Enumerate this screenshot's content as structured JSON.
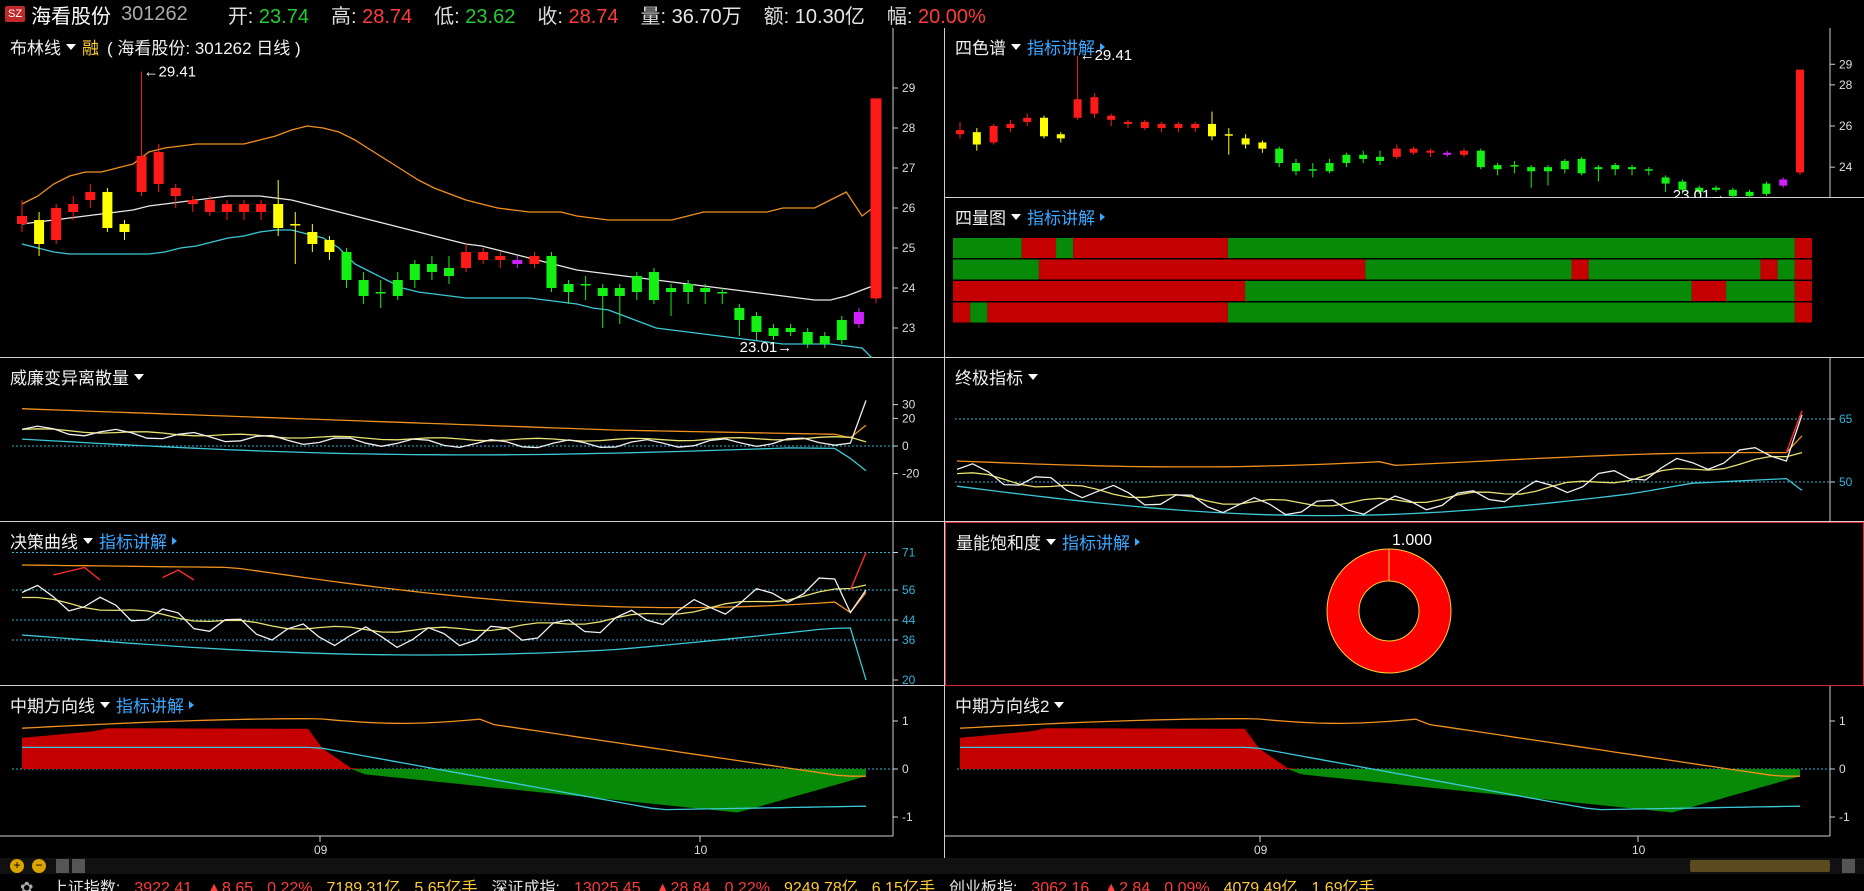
{
  "header": {
    "market_badge": "SZ",
    "stock_name": "海看股份",
    "stock_code": "301262",
    "quotes": [
      {
        "label": "开:",
        "value": "23.74",
        "tone": "dn"
      },
      {
        "label": "高:",
        "value": "28.74",
        "tone": "up"
      },
      {
        "label": "低:",
        "value": "23.62",
        "tone": "dn"
      },
      {
        "label": "收:",
        "value": "28.74",
        "tone": "up"
      },
      {
        "label": "量:",
        "value": "36.70万",
        "tone": "plain"
      },
      {
        "label": "额:",
        "value": "10.30亿",
        "tone": "plain"
      },
      {
        "label": "幅:",
        "value": "20.00%",
        "tone": "up"
      }
    ]
  },
  "panes": {
    "boll": {
      "title": "布林线",
      "margin_label": "融",
      "subtitle": "( 海看股份: 301262 日线 )",
      "yticks": [
        "29",
        "28",
        "27",
        "26",
        "25",
        "24",
        "23"
      ],
      "high_label": "←29.41",
      "low_label": "23.01→"
    },
    "sisepu": {
      "title": "四色谱",
      "link": "指标讲解",
      "yticks": [
        "29",
        "28",
        "26",
        "24"
      ],
      "high_label": "←29.41",
      "low_label": "23.01→"
    },
    "sixiangtu": {
      "title": "四量图",
      "link": "指标讲解"
    },
    "williams": {
      "title": "威廉变异离散量",
      "yticks": [
        "30",
        "20",
        "0",
        "-20"
      ]
    },
    "zhongji": {
      "title": "终极指标",
      "yticks": [
        "65",
        "50"
      ]
    },
    "juece": {
      "title": "决策曲线",
      "link": "指标讲解",
      "yticks": [
        "71",
        "56",
        "44",
        "36",
        "20"
      ]
    },
    "liangneng": {
      "title": "量能饱和度",
      "link": "指标讲解",
      "value_label": "1.000"
    },
    "zhongqi1": {
      "title": "中期方向线",
      "link": "指标讲解",
      "yticks": [
        "1",
        "0",
        "-1"
      ]
    },
    "zhongqi2": {
      "title": "中期方向线2",
      "yticks": [
        "1",
        "0",
        "-1"
      ]
    }
  },
  "time_axis": {
    "labels": [
      "09",
      "10"
    ]
  },
  "nav": {
    "zoom_in": "+",
    "zoom_out": "−"
  },
  "footer": {
    "items": [
      {
        "text": "上证指数:",
        "tone": "plain"
      },
      {
        "text": "3922.41",
        "tone": "up"
      },
      {
        "text": "▲8.65",
        "tone": "up"
      },
      {
        "text": "0.22%",
        "tone": "up"
      },
      {
        "text": "7189.31亿",
        "tone": "yl"
      },
      {
        "text": "5.65亿手",
        "tone": "yl"
      },
      {
        "text": "深证成指:",
        "tone": "plain"
      },
      {
        "text": "13025.45",
        "tone": "up"
      },
      {
        "text": "▲28.84",
        "tone": "up"
      },
      {
        "text": "0.22%",
        "tone": "up"
      },
      {
        "text": "9249.78亿",
        "tone": "yl"
      },
      {
        "text": "6.15亿手",
        "tone": "yl"
      },
      {
        "text": "创业板指:",
        "tone": "plain"
      },
      {
        "text": "3062.16",
        "tone": "up"
      },
      {
        "text": "▲2.84",
        "tone": "up"
      },
      {
        "text": "0.09%",
        "tone": "up"
      },
      {
        "text": "4079.49亿",
        "tone": "yl"
      },
      {
        "text": "1.69亿手",
        "tone": "yl"
      }
    ]
  },
  "colors": {
    "up": "#ff2020",
    "down": "#00e020",
    "accent_blue": "#3aa8ff",
    "gold": "#ffcc33"
  },
  "chart_data": {
    "type": "candlestick",
    "ylim": [
      22.5,
      29.5
    ],
    "candles": [
      {
        "o": 25.6,
        "c": 25.8,
        "h": 26.2,
        "l": 25.4,
        "col": "red"
      },
      {
        "o": 25.7,
        "c": 25.1,
        "h": 25.9,
        "l": 24.8,
        "col": "yellow"
      },
      {
        "o": 25.2,
        "c": 26.0,
        "h": 26.1,
        "l": 25.1,
        "col": "red"
      },
      {
        "o": 25.9,
        "c": 26.1,
        "h": 26.3,
        "l": 25.7,
        "col": "red"
      },
      {
        "o": 26.2,
        "c": 26.4,
        "h": 26.6,
        "l": 26.0,
        "col": "red"
      },
      {
        "o": 26.4,
        "c": 25.5,
        "h": 26.5,
        "l": 25.4,
        "col": "yellow"
      },
      {
        "o": 25.6,
        "c": 25.4,
        "h": 25.7,
        "l": 25.2,
        "col": "yellow"
      },
      {
        "o": 26.4,
        "c": 27.3,
        "h": 29.41,
        "l": 26.3,
        "col": "red"
      },
      {
        "o": 26.6,
        "c": 27.4,
        "h": 27.6,
        "l": 26.4,
        "col": "red"
      },
      {
        "o": 26.5,
        "c": 26.3,
        "h": 26.6,
        "l": 26.0,
        "col": "red"
      },
      {
        "o": 26.2,
        "c": 26.1,
        "h": 26.3,
        "l": 25.9,
        "col": "red"
      },
      {
        "o": 26.2,
        "c": 25.9,
        "h": 26.3,
        "l": 25.8,
        "col": "red"
      },
      {
        "o": 26.1,
        "c": 25.9,
        "h": 26.2,
        "l": 25.7,
        "col": "red"
      },
      {
        "o": 26.1,
        "c": 25.9,
        "h": 26.2,
        "l": 25.7,
        "col": "red"
      },
      {
        "o": 26.1,
        "c": 25.9,
        "h": 26.2,
        "l": 25.7,
        "col": "red"
      },
      {
        "o": 26.1,
        "c": 25.5,
        "h": 26.7,
        "l": 25.3,
        "col": "yellow"
      },
      {
        "o": 25.6,
        "c": 25.6,
        "h": 25.9,
        "l": 24.6,
        "col": "yellow"
      },
      {
        "o": 25.4,
        "c": 25.1,
        "h": 25.6,
        "l": 24.9,
        "col": "yellow"
      },
      {
        "o": 25.2,
        "c": 24.9,
        "h": 25.3,
        "l": 24.7,
        "col": "yellow"
      },
      {
        "o": 24.9,
        "c": 24.2,
        "h": 25.0,
        "l": 24.0,
        "col": "green"
      },
      {
        "o": 24.2,
        "c": 23.8,
        "h": 24.4,
        "l": 23.6,
        "col": "green"
      },
      {
        "o": 23.9,
        "c": 23.9,
        "h": 24.2,
        "l": 23.5,
        "col": "green"
      },
      {
        "o": 23.8,
        "c": 24.2,
        "h": 24.4,
        "l": 23.7,
        "col": "green"
      },
      {
        "o": 24.2,
        "c": 24.6,
        "h": 24.7,
        "l": 24.0,
        "col": "green"
      },
      {
        "o": 24.4,
        "c": 24.6,
        "h": 24.8,
        "l": 24.2,
        "col": "green"
      },
      {
        "o": 24.5,
        "c": 24.3,
        "h": 24.8,
        "l": 24.1,
        "col": "green"
      },
      {
        "o": 24.5,
        "c": 24.9,
        "h": 25.1,
        "l": 24.4,
        "col": "red"
      },
      {
        "o": 24.7,
        "c": 24.9,
        "h": 25.0,
        "l": 24.6,
        "col": "red"
      },
      {
        "o": 24.8,
        "c": 24.7,
        "h": 24.9,
        "l": 24.5,
        "col": "red"
      },
      {
        "o": 24.7,
        "c": 24.6,
        "h": 24.8,
        "l": 24.5,
        "col": "magenta"
      },
      {
        "o": 24.8,
        "c": 24.6,
        "h": 24.9,
        "l": 24.5,
        "col": "red"
      },
      {
        "o": 24.8,
        "c": 24.0,
        "h": 24.9,
        "l": 23.9,
        "col": "green"
      },
      {
        "o": 24.1,
        "c": 23.9,
        "h": 24.2,
        "l": 23.6,
        "col": "green"
      },
      {
        "o": 24.1,
        "c": 24.1,
        "h": 24.3,
        "l": 23.7,
        "col": "green"
      },
      {
        "o": 24.0,
        "c": 23.8,
        "h": 24.1,
        "l": 23.0,
        "col": "green"
      },
      {
        "o": 23.8,
        "c": 24.0,
        "h": 24.1,
        "l": 23.1,
        "col": "green"
      },
      {
        "o": 23.9,
        "c": 24.3,
        "h": 24.4,
        "l": 23.7,
        "col": "green"
      },
      {
        "o": 24.4,
        "c": 23.7,
        "h": 24.5,
        "l": 23.6,
        "col": "green"
      },
      {
        "o": 23.9,
        "c": 24.0,
        "h": 24.1,
        "l": 23.3,
        "col": "green"
      },
      {
        "o": 24.1,
        "c": 23.9,
        "h": 24.2,
        "l": 23.6,
        "col": "green"
      },
      {
        "o": 23.9,
        "c": 24.0,
        "h": 24.1,
        "l": 23.6,
        "col": "green"
      },
      {
        "o": 23.9,
        "c": 23.9,
        "h": 24.0,
        "l": 23.6,
        "col": "green"
      },
      {
        "o": 23.5,
        "c": 23.2,
        "h": 23.6,
        "l": 22.8,
        "col": "green"
      },
      {
        "o": 23.3,
        "c": 22.9,
        "h": 23.4,
        "l": 22.7,
        "col": "green"
      },
      {
        "o": 23.0,
        "c": 22.8,
        "h": 23.1,
        "l": 22.7,
        "col": "green"
      },
      {
        "o": 22.9,
        "c": 23.0,
        "h": 23.1,
        "l": 22.8,
        "col": "green"
      },
      {
        "o": 22.9,
        "c": 22.6,
        "h": 23.0,
        "l": 22.5,
        "col": "green"
      },
      {
        "o": 22.6,
        "c": 22.8,
        "h": 22.9,
        "l": 22.5,
        "col": "green"
      },
      {
        "o": 22.7,
        "c": 23.2,
        "h": 23.3,
        "l": 22.6,
        "col": "green"
      },
      {
        "o": 23.1,
        "c": 23.4,
        "h": 23.5,
        "l": 23.0,
        "col": "magenta"
      },
      {
        "o": 23.74,
        "c": 28.74,
        "h": 28.74,
        "l": 23.62,
        "col": "red"
      }
    ],
    "bands": {
      "upper": [
        26.1,
        26.3,
        26.6,
        26.8,
        26.9,
        26.9,
        27.0,
        27.1,
        27.4,
        27.5,
        27.55,
        27.6,
        27.6,
        27.6,
        27.6,
        27.7,
        27.8,
        27.95,
        28.05,
        28.0,
        27.9,
        27.7,
        27.45,
        27.2,
        26.95,
        26.7,
        26.5,
        26.35,
        26.2,
        26.1,
        26.0,
        25.95,
        25.9,
        25.9,
        25.9,
        25.8,
        25.75,
        25.7,
        25.7,
        25.7,
        25.7,
        25.7,
        25.8,
        25.9,
        25.9,
        25.9,
        25.9,
        25.9,
        26.0,
        26.0,
        26.0,
        26.2,
        26.4,
        25.8,
        26.1
      ],
      "mid": [
        25.6,
        25.65,
        25.7,
        25.75,
        25.8,
        25.85,
        25.9,
        25.95,
        26.05,
        26.1,
        26.15,
        26.2,
        26.25,
        26.3,
        26.3,
        26.3,
        26.25,
        26.2,
        26.1,
        26.0,
        25.9,
        25.8,
        25.7,
        25.6,
        25.5,
        25.4,
        25.3,
        25.2,
        25.1,
        25.05,
        24.95,
        24.85,
        24.75,
        24.65,
        24.55,
        24.45,
        24.4,
        24.35,
        24.3,
        24.25,
        24.2,
        24.15,
        24.1,
        24.05,
        24.0,
        23.95,
        23.9,
        23.85,
        23.8,
        23.75,
        23.7,
        23.7,
        23.8,
        23.95,
        24.1
      ],
      "lower": [
        25.1,
        25.0,
        24.9,
        24.85,
        24.85,
        24.85,
        24.85,
        24.85,
        24.85,
        24.9,
        25.0,
        25.05,
        25.15,
        25.25,
        25.3,
        25.4,
        25.45,
        25.45,
        25.35,
        25.25,
        25.0,
        24.6,
        24.4,
        24.2,
        24.0,
        23.9,
        23.85,
        23.8,
        23.75,
        23.75,
        23.75,
        23.75,
        23.75,
        23.7,
        23.65,
        23.6,
        23.5,
        23.45,
        23.3,
        23.15,
        23.0,
        22.95,
        22.9,
        22.85,
        22.8,
        22.75,
        22.7,
        22.65,
        22.6,
        22.6,
        22.6,
        22.6,
        22.55,
        22.5,
        22.1
      ]
    }
  }
}
